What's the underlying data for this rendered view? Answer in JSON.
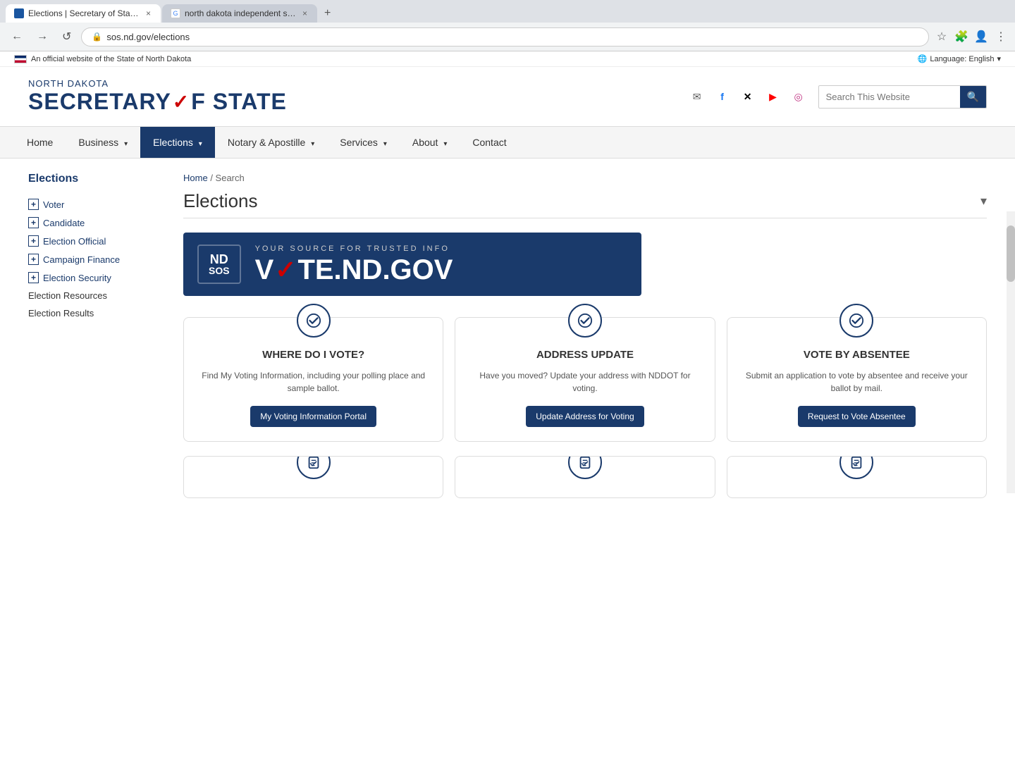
{
  "browser": {
    "tabs": [
      {
        "id": "tab1",
        "favicon_type": "nd",
        "title": "Elections | Secretary of State | N...",
        "active": true
      },
      {
        "id": "tab2",
        "favicon_type": "google",
        "title": "north dakota independent stat...",
        "active": false
      }
    ],
    "add_tab_label": "+",
    "address": "sos.nd.gov/elections",
    "nav_back": "←",
    "nav_forward": "→",
    "nav_reload": "↺"
  },
  "topbar": {
    "official_text": "An official website of the State of North Dakota",
    "language_label": "Language: English"
  },
  "header": {
    "logo_pre": "NORTH DAKOTA",
    "logo_main1": "SECRETARY ",
    "logo_check": "✓",
    "logo_main2": "F STATE",
    "search_placeholder": "Search This Website",
    "search_btn_icon": "🔍"
  },
  "nav": {
    "items": [
      {
        "label": "Home",
        "active": false,
        "has_arrow": false
      },
      {
        "label": "Business",
        "active": false,
        "has_arrow": true
      },
      {
        "label": "Elections",
        "active": true,
        "has_arrow": true
      },
      {
        "label": "Notary & Apostille",
        "active": false,
        "has_arrow": true
      },
      {
        "label": "Services",
        "active": false,
        "has_arrow": true
      },
      {
        "label": "About",
        "active": false,
        "has_arrow": true
      },
      {
        "label": "Contact",
        "active": false,
        "has_arrow": false
      }
    ]
  },
  "sidebar": {
    "title": "Elections",
    "items": [
      {
        "label": "Voter",
        "expandable": true
      },
      {
        "label": "Candidate",
        "expandable": true
      },
      {
        "label": "Election Official",
        "expandable": true
      },
      {
        "label": "Campaign Finance",
        "expandable": true
      },
      {
        "label": "Election Security",
        "expandable": true
      },
      {
        "label": "Election Resources",
        "expandable": false
      },
      {
        "label": "Election Results",
        "expandable": false
      }
    ]
  },
  "content": {
    "breadcrumb_home": "Home",
    "breadcrumb_sep": " / ",
    "breadcrumb_current": "Search",
    "page_title": "Elections",
    "banner": {
      "logo_nd": "ND",
      "logo_sos": "SOS",
      "tagline": "YOUR SOURCE FOR TRUSTED INFO",
      "site": "VOTE.ND.GOV"
    },
    "cards": [
      {
        "icon": "✓",
        "title": "WHERE DO I VOTE?",
        "desc": "Find My Voting Information, including your polling place and sample ballot.",
        "btn_label": "My Voting Information Portal"
      },
      {
        "icon": "✓",
        "title": "ADDRESS UPDATE",
        "desc": "Have you moved? Update your address with NDDOT for voting.",
        "btn_label": "Update Address for Voting"
      },
      {
        "icon": "✓",
        "title": "VOTE BY ABSENTEE",
        "desc": "Submit an application to vote by absentee and receive your ballot by mail.",
        "btn_label": "Request to Vote Absentee"
      }
    ],
    "cards_bottom": [
      {
        "icon": "📋"
      },
      {
        "icon": "📋"
      },
      {
        "icon": "📋"
      }
    ]
  },
  "social": {
    "email_icon": "✉",
    "facebook_icon": "f",
    "x_icon": "✕",
    "youtube_icon": "▶",
    "instagram_icon": "◉"
  }
}
